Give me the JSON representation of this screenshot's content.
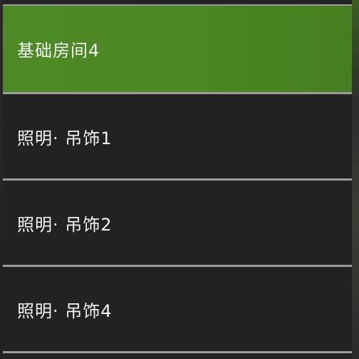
{
  "menu": {
    "items": [
      {
        "label": "基础房间4",
        "selected": true
      },
      {
        "label": "照明· 吊饰1",
        "selected": false
      },
      {
        "label": "照明· 吊饰2",
        "selected": false
      },
      {
        "label": "照明· 吊饰4",
        "selected": false
      }
    ]
  },
  "colors": {
    "selected_bg": "#4a8823",
    "item_bg": "#222222",
    "divider": "#9c9c9c",
    "text": "#f2f2f2"
  }
}
